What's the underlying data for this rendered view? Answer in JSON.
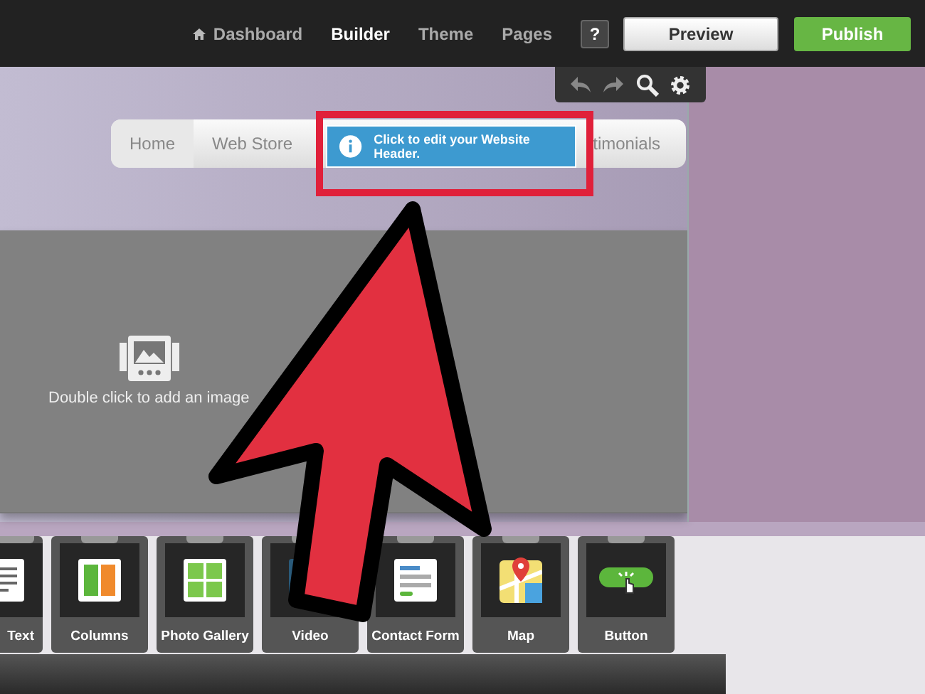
{
  "top_nav": [
    {
      "label": "Dashboard",
      "kind": "home",
      "selected": false
    },
    {
      "label": "Builder",
      "kind": "plain",
      "selected": true
    },
    {
      "label": "Theme",
      "kind": "plain",
      "selected": false
    },
    {
      "label": "Pages",
      "kind": "plain",
      "selected": false
    }
  ],
  "help": "?",
  "preview": "Preview",
  "publish": "Publish",
  "site_menu": [
    {
      "label": "Home",
      "selected": true
    },
    {
      "label": "Web Store",
      "selected": false
    },
    {
      "label": "timonials",
      "selected": false
    }
  ],
  "tooltip": "Click to edit your Website Header.",
  "image_placeholder": "Double click to add an image",
  "widgets": [
    {
      "label": "Text",
      "kind": "text"
    },
    {
      "label": "Columns",
      "kind": "columns"
    },
    {
      "label": "Photo Gallery",
      "kind": "gallery"
    },
    {
      "label": "Video",
      "kind": "video"
    },
    {
      "label": "Contact Form",
      "kind": "form"
    },
    {
      "label": "Map",
      "kind": "map"
    },
    {
      "label": "Button",
      "kind": "button"
    }
  ]
}
